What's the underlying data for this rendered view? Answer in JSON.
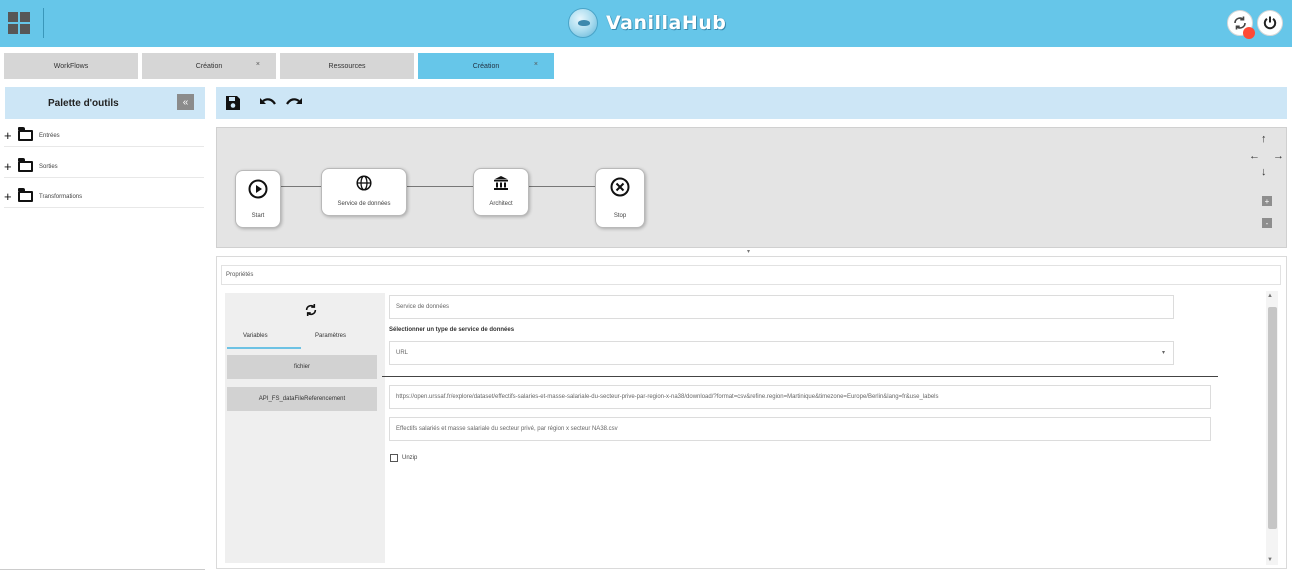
{
  "header": {
    "brand": "VanillaHub",
    "notification_count": ""
  },
  "tabs": [
    {
      "label": "WorkFlows",
      "closable": false,
      "active": false
    },
    {
      "label": "Création",
      "closable": true,
      "active": false
    },
    {
      "label": "Ressources",
      "closable": false,
      "active": false
    },
    {
      "label": "Création",
      "closable": true,
      "active": true
    }
  ],
  "palette": {
    "title": "Palette d'outils",
    "collapse_icon": "«",
    "items": [
      {
        "label": "Entrées"
      },
      {
        "label": "Sorties"
      },
      {
        "label": "Transformations"
      }
    ]
  },
  "workflow": {
    "nodes": [
      {
        "label": "Start",
        "icon": "play-icon"
      },
      {
        "label": "Service de données",
        "icon": "globe-icon"
      },
      {
        "label": "Architect",
        "icon": "bank-icon"
      },
      {
        "label": "Stop",
        "icon": "stop-icon"
      }
    ],
    "zoom_in": "+",
    "zoom_out": "-"
  },
  "properties": {
    "title": "Propriétés",
    "subtabs": [
      "Variables",
      "Paramètres"
    ],
    "variables": [
      "fichier",
      "API_FS_dataFileReferencement"
    ],
    "name_value": "Service de données",
    "select_label": "Sélectionner un type de service de données",
    "select_value": "URL",
    "url_value": "https://open.urssaf.fr/explore/dataset/effectifs-salaries-et-masse-salariale-du-secteur-prive-par-region-x-na38/download/?format=csv&refine.region=Martinique&timezone=Europe/Berlin&lang=fr&use_labels",
    "description_value": "Effectifs salariés et masse salariale du secteur privé, par région x secteur NA38.csv",
    "checkbox_label": "Unzip",
    "checkbox_checked": false
  },
  "colors": {
    "header": "#66c6e9",
    "toolbar": "#cde6f6",
    "badge": "#ff4a36",
    "accent": "#6dc2e4"
  }
}
